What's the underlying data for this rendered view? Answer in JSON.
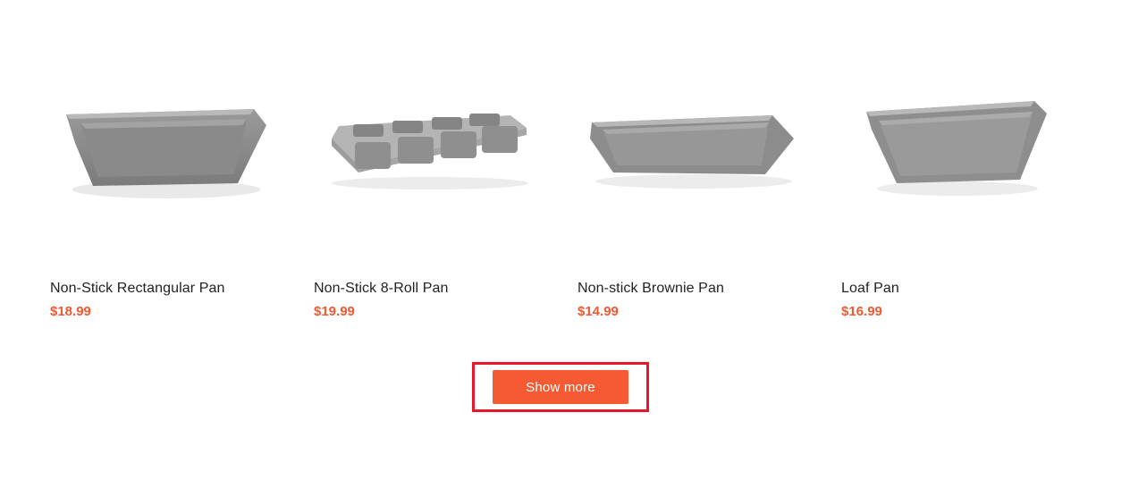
{
  "products": [
    {
      "name": "Non-Stick Rectangular Pan",
      "price": "$18.99",
      "image_icon": "rectangular-pan-image"
    },
    {
      "name": "Non-Stick 8-Roll Pan",
      "price": "$19.99",
      "image_icon": "roll-pan-image"
    },
    {
      "name": "Non-stick Brownie Pan",
      "price": "$14.99",
      "image_icon": "brownie-pan-image"
    },
    {
      "name": "Loaf Pan",
      "price": "$16.99",
      "image_icon": "loaf-pan-image"
    }
  ],
  "show_more": {
    "label": "Show more"
  },
  "colors": {
    "price": "#f05a32",
    "button": "#f55a32",
    "highlight": "#e8162a"
  }
}
